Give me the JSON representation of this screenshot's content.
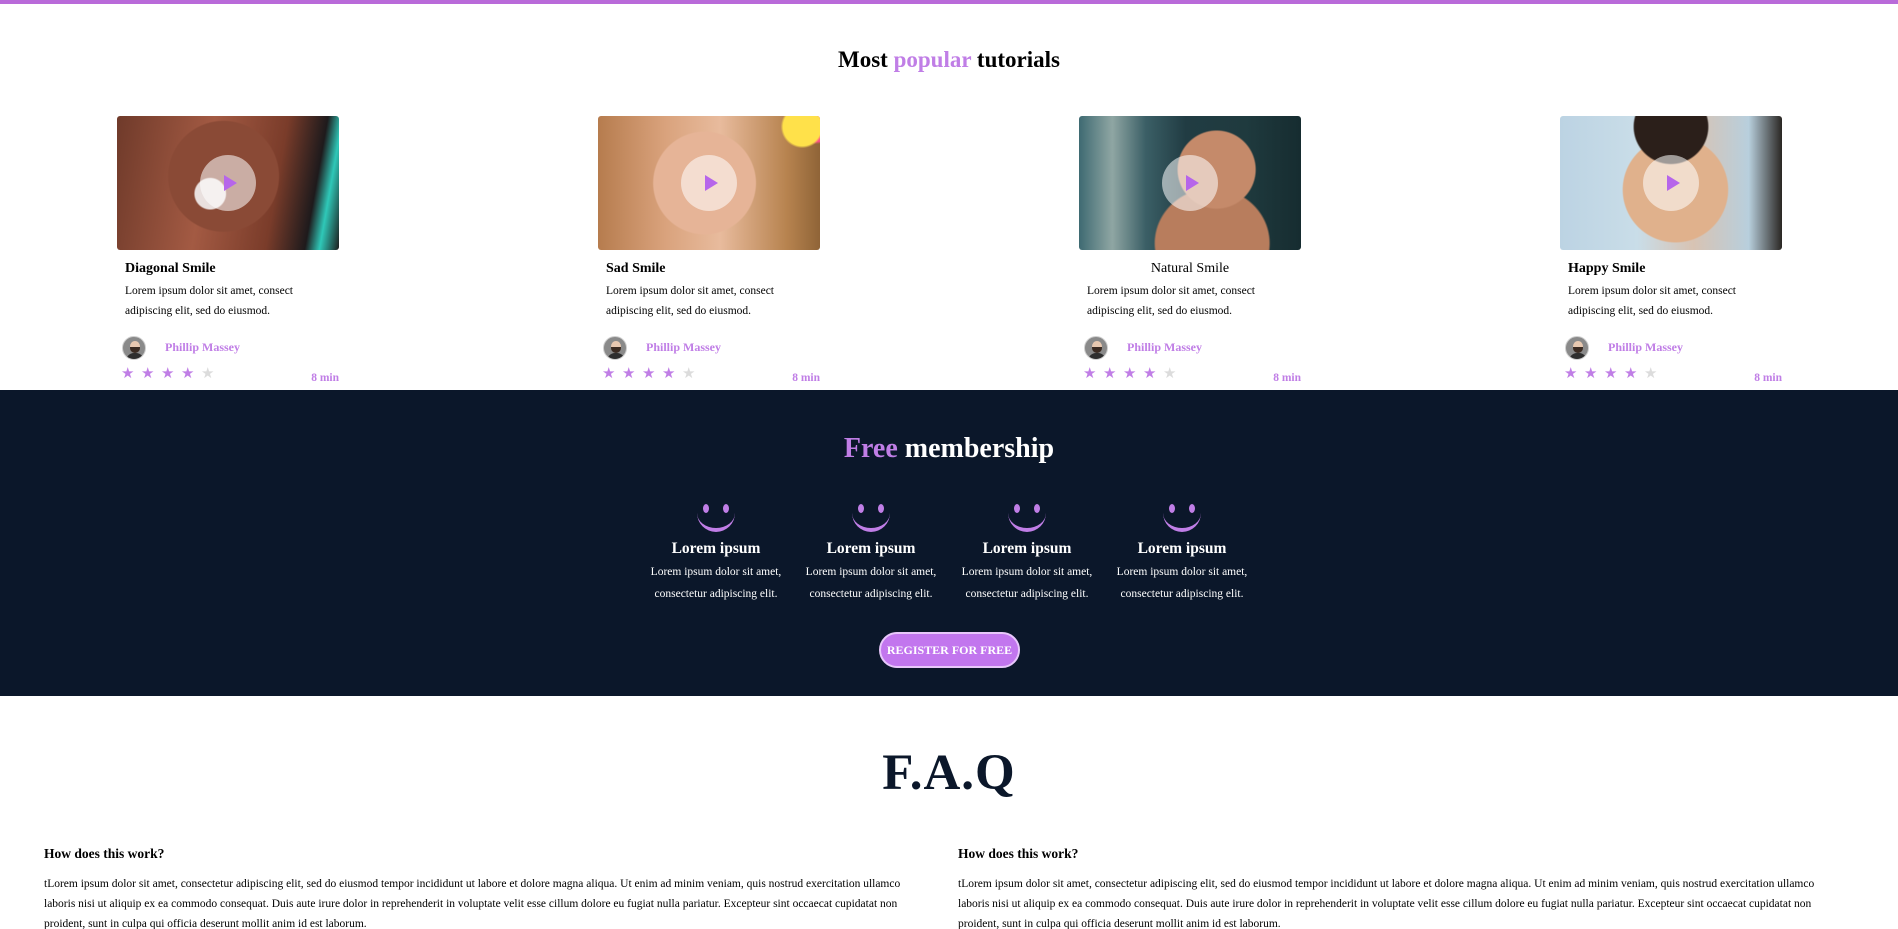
{
  "popular": {
    "title_lead": "Most",
    "title_accent": "popular",
    "title_tail": "tutorials",
    "cards": [
      {
        "title": "Diagonal Smile",
        "desc": "Lorem ipsum dolor sit amet, consect adipiscing elit, sed do eiusmod.",
        "author": "Phillip Massey",
        "rating": 4,
        "duration": "8 min"
      },
      {
        "title": "Sad Smile",
        "desc": "Lorem ipsum dolor sit amet, consect adipiscing elit, sed do eiusmod.",
        "author": "Phillip Massey",
        "rating": 4,
        "duration": "8 min"
      },
      {
        "title": "Natural Smile",
        "desc": "Lorem ipsum dolor sit amet, consect adipiscing elit, sed do eiusmod.",
        "author": "Phillip Massey",
        "rating": 4,
        "duration": "8 min"
      },
      {
        "title": "Happy Smile",
        "desc": "Lorem ipsum dolor sit amet, consect adipiscing elit, sed do eiusmod.",
        "author": "Phillip Massey",
        "rating": 4,
        "duration": "8 min"
      }
    ]
  },
  "membership": {
    "title_accent": "Free",
    "title_tail": "membership",
    "benefits": [
      {
        "title": "Lorem ipsum",
        "desc": "Lorem ipsum dolor sit amet, consectetur adipiscing elit."
      },
      {
        "title": "Lorem ipsum",
        "desc": "Lorem ipsum dolor sit amet, consectetur adipiscing elit."
      },
      {
        "title": "Lorem ipsum",
        "desc": "Lorem ipsum dolor sit amet, consectetur adipiscing elit."
      },
      {
        "title": "Lorem ipsum",
        "desc": "Lorem ipsum dolor sit amet, consectetur adipiscing elit."
      }
    ],
    "register_label": "REGISTER FOR FREE"
  },
  "faq": {
    "title": "F.A.Q",
    "items": [
      {
        "question": "How does this work?",
        "answer": "tLorem ipsum dolor sit amet, consectetur adipiscing elit, sed do eiusmod tempor incididunt ut labore et dolore magna aliqua. Ut enim ad minim veniam, quis nostrud exercitation ullamco laboris nisi ut aliquip ex ea commodo consequat. Duis aute irure dolor in reprehenderit in voluptate velit esse cillum dolore eu fugiat nulla pariatur. Excepteur sint occaecat cupidatat non proident, sunt in culpa qui officia deserunt mollit anim id est laborum."
      },
      {
        "question": "How does this work?",
        "answer": "tLorem ipsum dolor sit amet, consectetur adipiscing elit, sed do eiusmod tempor incididunt ut labore et dolore magna aliqua. Ut enim ad minim veniam, quis nostrud exercitation ullamco laboris nisi ut aliquip ex ea commodo consequat. Duis aute irure dolor in reprehenderit in voluptate velit esse cillum dolore eu fugiat nulla pariatur. Excepteur sint occaecat cupidatat non proident, sunt in culpa qui officia deserunt mollit anim id est laborum."
      }
    ]
  },
  "colors": {
    "accent": "#c07ee6",
    "dark_bg": "#0b172a",
    "button": "#c276ee"
  },
  "icons": {
    "play": "play-icon",
    "star": "star-icon",
    "benefit": "smile-icon"
  }
}
